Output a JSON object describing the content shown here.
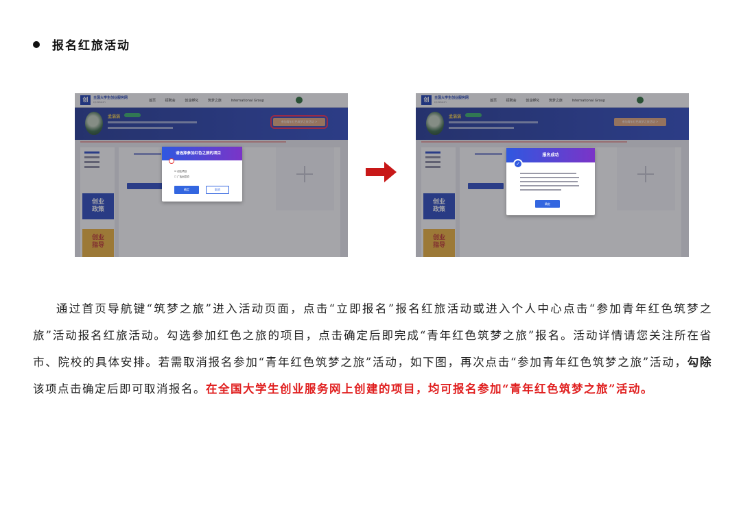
{
  "heading": {
    "text": "报名红旅活动"
  },
  "screenshot_left": {
    "site_name": "全国大学生创业服务网",
    "site_sub": "cy.ncss.cn",
    "nav_links": [
      "首页",
      "招聘会",
      "创业孵化",
      "筑梦之旅",
      "International Group"
    ],
    "banner_name": "孟涓涓",
    "join_button": "参加青年红色筑梦之旅活动 >",
    "dialog_title": "请选择参加红色之旅的项目",
    "dialog_options": [
      "☑ 创业项目",
      "☐ 广告创意项"
    ],
    "dialog_ok": "确定",
    "dialog_cancel": "取消",
    "card_blue": "创业\n政策",
    "card_orange": "创业\n指导"
  },
  "screenshot_right": {
    "site_name": "全国大学生创业服务网",
    "site_sub": "cy.ncss.cn",
    "nav_links": [
      "首页",
      "招聘会",
      "创业孵化",
      "筑梦之旅",
      "International Group"
    ],
    "banner_name": "孟涓涓",
    "join_button": "参加青年红色筑梦之旅活动 >",
    "dialog_title": "报名成功",
    "dialog_ok": "确定",
    "card_blue": "创业\n政策",
    "card_orange": "创业\n指导"
  },
  "arrow_color": "#c81818",
  "paragraph": {
    "part1": "通过首页导航键“筑梦之旅”进入活动页面，点击“立即报名”报名红旅活动或进入个人中心点击“参加青年红色筑梦之旅”活动报名红旅活动。勾选参加红色之旅的项目，点击确定后即完成“青年红色筑梦之旅”报名。活动详情请您关注所在省市、院校的具体安排。若需取消报名参加“青年红色筑梦之旅”活动，如下图，再次点击“参加青年红色筑梦之旅”活动，",
    "bold": "勾除",
    "part2": "该项点击确定后即可取消报名。",
    "red": "在全国大学生创业服务网上创建的项目，均可报名参加“青年红色筑梦之旅”活动。"
  }
}
